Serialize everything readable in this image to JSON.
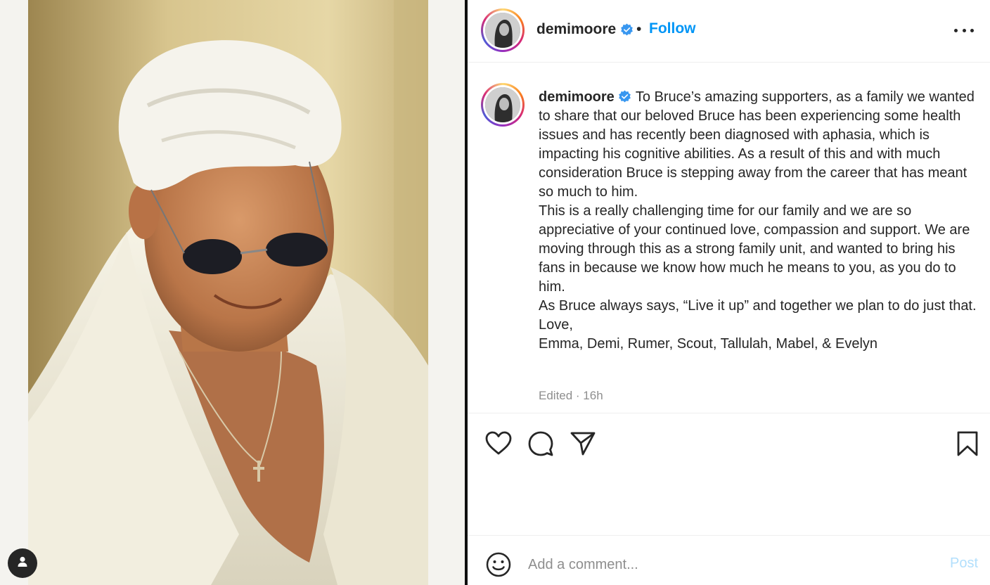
{
  "post": {
    "username": "demimoore",
    "verified": true,
    "follow_label": "Follow",
    "bullet": "•",
    "caption_paragraphs": [
      "To Bruce’s amazing supporters, as a family we wanted to share that our beloved Bruce has been experiencing some health issues and has recently been diagnosed with aphasia, which is impacting his cognitive abilities. As a result of this and with much consideration Bruce is stepping away from the career that has meant so much to him.",
      "This is a really challenging time for our family and we are so appreciative of your continued love, compassion and support. We are moving through this as a strong family unit, and wanted to bring his fans in because we know how much he means to you, as you do to him.",
      "As Bruce always says, “Live it up” and together we plan to do just that.",
      "Love,",
      "Emma, Demi, Rumer, Scout, Tallulah, Mabel, & Evelyn"
    ],
    "timestamp": "Edited · 16h"
  },
  "comment": {
    "placeholder": "Add a comment...",
    "post_label": "Post"
  },
  "icons": {
    "like": "heart-icon",
    "comment": "comment-bubble-icon",
    "share": "paper-plane-icon",
    "save": "bookmark-icon",
    "emoji": "smiley-icon",
    "more": "more-options-icon",
    "tag": "user-tag-icon",
    "verified": "verified-badge-icon"
  },
  "colors": {
    "link": "#0095f6",
    "verified": "#3897f0",
    "muted": "#8e8e8e",
    "post_disabled": "#b2dffc"
  }
}
